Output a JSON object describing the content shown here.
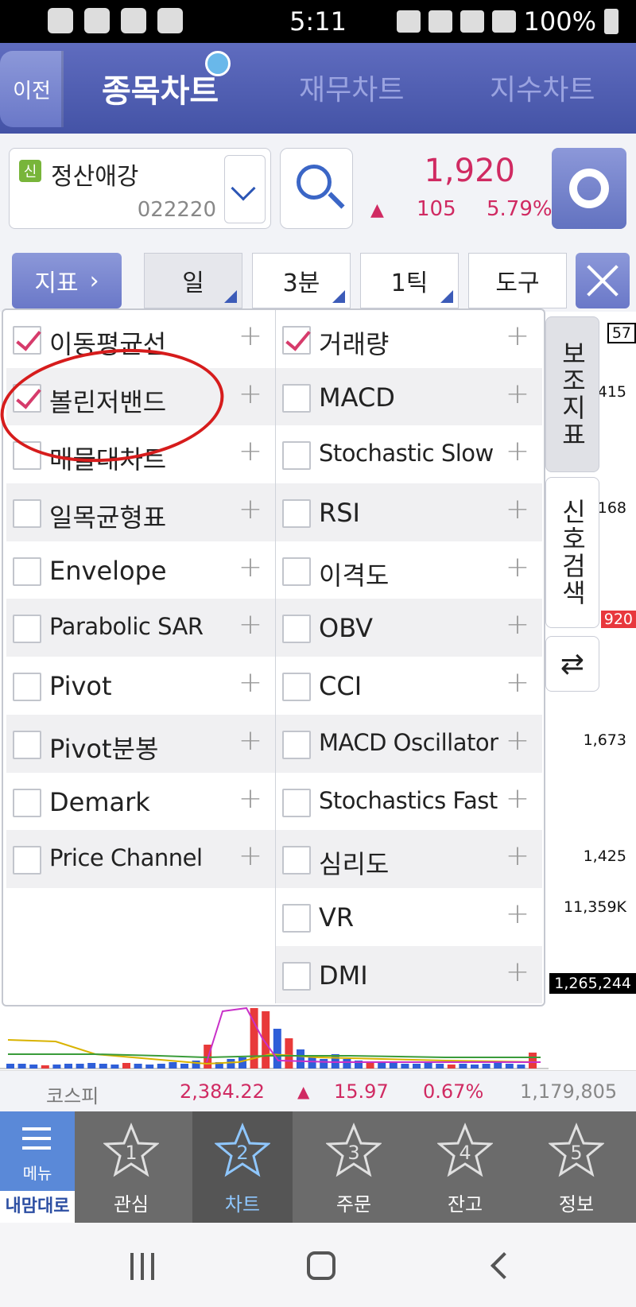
{
  "status_bar": {
    "time": "5:11",
    "battery": "100%"
  },
  "header": {
    "back_label": "이전",
    "tabs": [
      {
        "label": "종목차트"
      },
      {
        "label": "재무차트"
      },
      {
        "label": "지수차트"
      }
    ]
  },
  "stock": {
    "badge": "신",
    "name": "정산애강",
    "code": "022220",
    "price": "1,920",
    "change_symbol": "▲",
    "change": "105",
    "change_pct": "5.79%"
  },
  "toolbar": {
    "indicator_label": "지표",
    "period": "일",
    "minute": "3분",
    "tick": "1틱",
    "tools": "도구"
  },
  "side_tabs": {
    "aux": "보조지표",
    "signal": "신호검색"
  },
  "axis_labels": {
    "top": "57",
    "a1": "415",
    "a2": "168",
    "current": "920",
    "a3": "1,673",
    "a4": "1,425",
    "vol_max": "11,359K",
    "vol_cur": "1,265,244"
  },
  "indicators": {
    "left": [
      {
        "label": "이동평균선",
        "checked": true
      },
      {
        "label": "볼린저밴드",
        "checked": true
      },
      {
        "label": "매물대차트",
        "checked": false
      },
      {
        "label": "일목균형표",
        "checked": false
      },
      {
        "label": "Envelope",
        "checked": false
      },
      {
        "label": "Parabolic SAR",
        "checked": false
      },
      {
        "label": "Pivot",
        "checked": false
      },
      {
        "label": "Pivot분봉",
        "checked": false
      },
      {
        "label": "Demark",
        "checked": false
      },
      {
        "label": "Price Channel",
        "checked": false
      }
    ],
    "right": [
      {
        "label": "거래량",
        "checked": true
      },
      {
        "label": "MACD",
        "checked": false
      },
      {
        "label": "Stochastic Slow",
        "checked": false
      },
      {
        "label": "RSI",
        "checked": false
      },
      {
        "label": "이격도",
        "checked": false
      },
      {
        "label": "OBV",
        "checked": false
      },
      {
        "label": "CCI",
        "checked": false
      },
      {
        "label": "MACD Oscillator",
        "checked": false
      },
      {
        "label": "Stochastics Fast",
        "checked": false
      },
      {
        "label": "심리도",
        "checked": false
      },
      {
        "label": "VR",
        "checked": false
      },
      {
        "label": "DMI",
        "checked": false
      }
    ],
    "plus": "+"
  },
  "kospi": {
    "label": "코스피",
    "value": "2,384.22",
    "symbol": "▲",
    "change": "15.97",
    "pct": "0.67%",
    "volume": "1,179,805"
  },
  "bottom_nav": {
    "menu": "메뉴",
    "menu_bottom": "내맘대로",
    "items": [
      {
        "num": "1",
        "label": "관심"
      },
      {
        "num": "2",
        "label": "차트"
      },
      {
        "num": "3",
        "label": "주문"
      },
      {
        "num": "4",
        "label": "잔고"
      },
      {
        "num": "5",
        "label": "정보"
      }
    ]
  },
  "colors": {
    "accent": "#4453a6",
    "up": "#d02a62",
    "highlight": "#d61c1c"
  }
}
